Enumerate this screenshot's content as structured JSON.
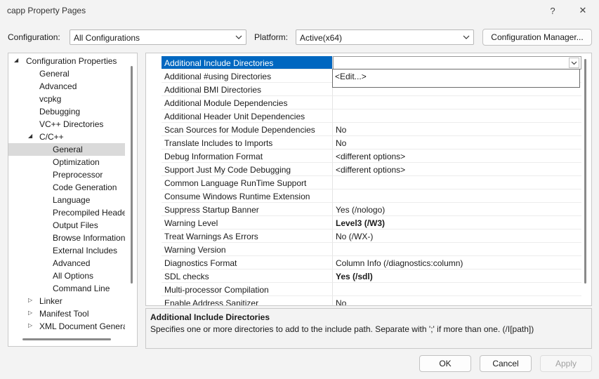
{
  "window": {
    "title": "capp Property Pages",
    "help_glyph": "?",
    "close_glyph": "✕"
  },
  "config_bar": {
    "configuration_label": "Configuration:",
    "configuration_value": "All Configurations",
    "platform_label": "Platform:",
    "platform_value": "Active(x64)",
    "manager_button": "Configuration Manager..."
  },
  "tree": {
    "items": [
      {
        "label": "Configuration Properties",
        "toggle": "expanded"
      },
      {
        "label": "General"
      },
      {
        "label": "Advanced"
      },
      {
        "label": "vcpkg"
      },
      {
        "label": "Debugging"
      },
      {
        "label": "VC++ Directories"
      },
      {
        "label": "C/C++",
        "toggle": "expanded"
      },
      {
        "label": "General",
        "selected": true
      },
      {
        "label": "Optimization"
      },
      {
        "label": "Preprocessor"
      },
      {
        "label": "Code Generation"
      },
      {
        "label": "Language"
      },
      {
        "label": "Precompiled Heade"
      },
      {
        "label": "Output Files"
      },
      {
        "label": "Browse Information"
      },
      {
        "label": "External Includes"
      },
      {
        "label": "Advanced"
      },
      {
        "label": "All Options"
      },
      {
        "label": "Command Line"
      },
      {
        "label": "Linker",
        "toggle": "collapsed"
      },
      {
        "label": "Manifest Tool",
        "toggle": "collapsed"
      },
      {
        "label": "XML Document Genera",
        "toggle": "collapsed"
      }
    ]
  },
  "properties": {
    "rows": [
      {
        "name": "Additional Include Directories",
        "value": "",
        "selected": true
      },
      {
        "name": "Additional #using Directories",
        "value": ""
      },
      {
        "name": "Additional BMI Directories",
        "value": ""
      },
      {
        "name": "Additional Module Dependencies",
        "value": ""
      },
      {
        "name": "Additional Header Unit Dependencies",
        "value": ""
      },
      {
        "name": "Scan Sources for Module Dependencies",
        "value": "No"
      },
      {
        "name": "Translate Includes to Imports",
        "value": "No"
      },
      {
        "name": "Debug Information Format",
        "value": "<different options>"
      },
      {
        "name": "Support Just My Code Debugging",
        "value": "<different options>"
      },
      {
        "name": "Common Language RunTime Support",
        "value": ""
      },
      {
        "name": "Consume Windows Runtime Extension",
        "value": ""
      },
      {
        "name": "Suppress Startup Banner",
        "value": "Yes (/nologo)"
      },
      {
        "name": "Warning Level",
        "value": "Level3 (/W3)",
        "bold": true
      },
      {
        "name": "Treat Warnings As Errors",
        "value": "No (/WX-)"
      },
      {
        "name": "Warning Version",
        "value": ""
      },
      {
        "name": "Diagnostics Format",
        "value": "Column Info (/diagnostics:column)"
      },
      {
        "name": "SDL checks",
        "value": "Yes (/sdl)",
        "bold": true
      },
      {
        "name": "Multi-processor Compilation",
        "value": ""
      },
      {
        "name": "Enable Address Sanitizer",
        "value": "No"
      }
    ],
    "dropdown_option": "<Edit...>"
  },
  "description": {
    "title": "Additional Include Directories",
    "text": "Specifies one or more directories to add to the include path. Separate with ';' if more than one.      (/I[path])"
  },
  "buttons": {
    "ok": "OK",
    "cancel": "Cancel",
    "apply": "Apply"
  }
}
